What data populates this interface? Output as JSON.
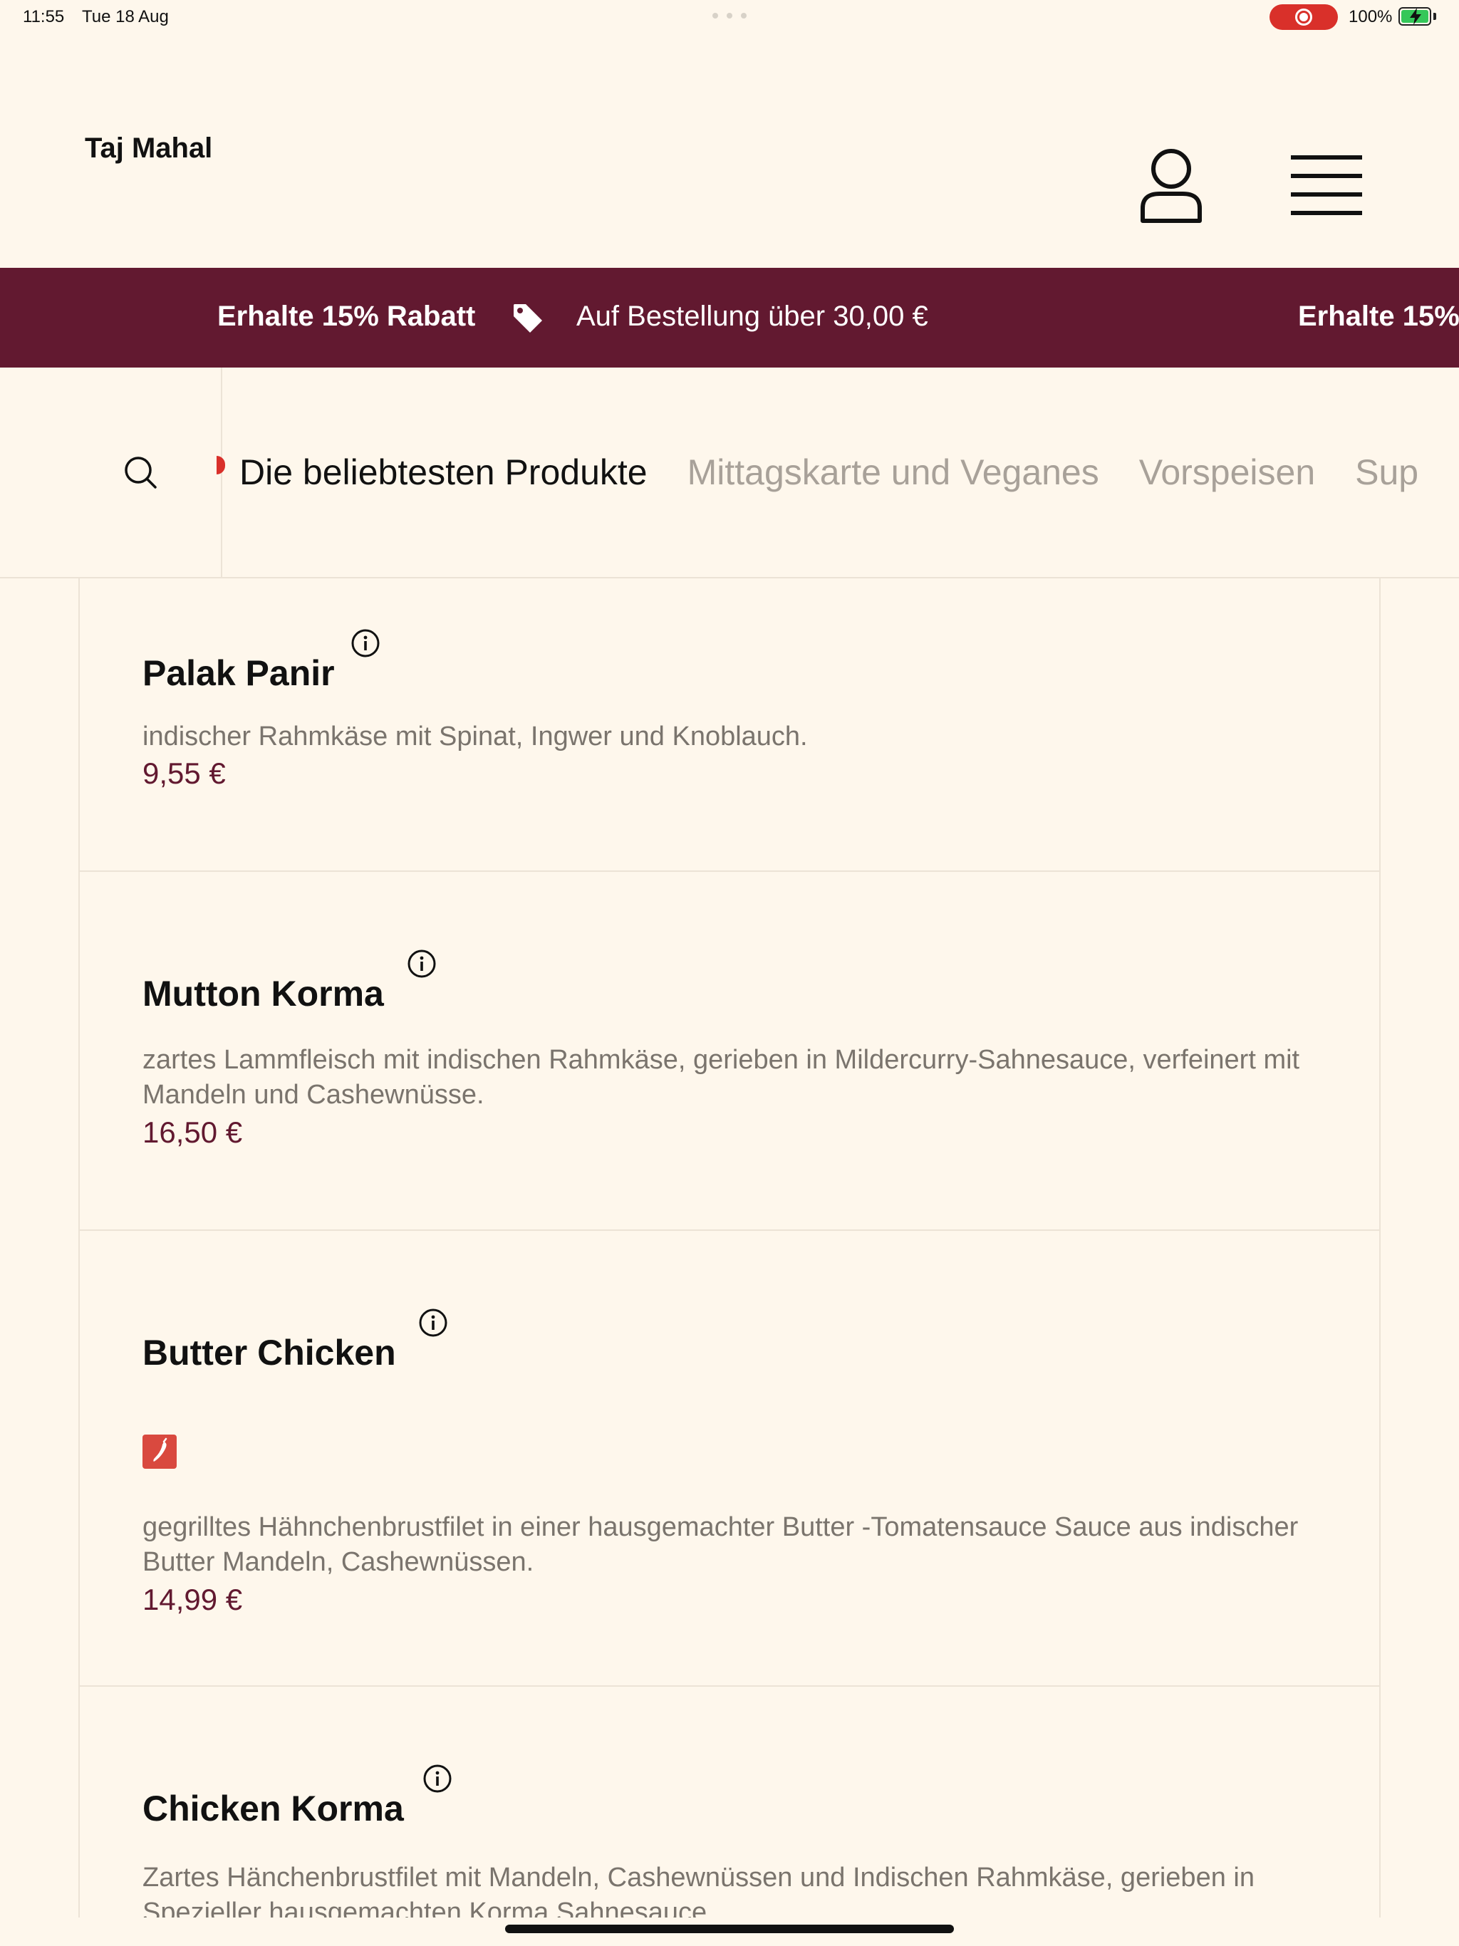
{
  "status_bar": {
    "time": "11:55",
    "date": "Tue 18 Aug",
    "battery": "100%",
    "battery_level": 1.0
  },
  "header": {
    "brand": "Taj Mahal",
    "account_icon": "user-icon",
    "menu_icon": "hamburger-menu-icon"
  },
  "promo": {
    "title": "Erhalte 15% Rabatt",
    "subtitle": "Auf Bestellung über 30,00 €",
    "title_repeat": "Erhalte 15%",
    "tag_icon": "price-tag-icon"
  },
  "categories": {
    "search_icon": "search-icon",
    "tabs": [
      {
        "label": "Die beliebtesten Produkte",
        "active": true
      },
      {
        "label": "Mittagskarte und Veganes",
        "active": false
      },
      {
        "label": "Vorspeisen",
        "active": false
      },
      {
        "label": "Sup",
        "active": false
      }
    ]
  },
  "products": [
    {
      "name": "Palak Panir",
      "description": "indischer Rahmkäse mit Spinat, Ingwer und Knoblauch.",
      "price": "9,55 €",
      "spicy": false
    },
    {
      "name": "Mutton Korma",
      "description": "zartes Lammfleisch mit indischen Rahmkäse, gerieben in Mildercurry-Sahnesauce, verfeinert mit Mandeln und Cashewnüsse.",
      "price": "16,50 €",
      "spicy": false
    },
    {
      "name": "Butter Chicken",
      "description": "gegrilltes Hähnchenbrustfilet in einer hausgemachter Butter -Tomatensauce Sauce aus indischer Butter Mandeln, Cashewnüssen.",
      "price": "14,99 €",
      "spicy": true
    },
    {
      "name": "Chicken Korma",
      "description": "Zartes Hänchenbrustfilet mit Mandeln, Cashewnüssen und Indischen Rahmkäse, gerieben in Spezieller hausgemachten Korma Sahnesauce.",
      "price": "",
      "spicy": false
    }
  ],
  "colors": {
    "background": "#fef7ec",
    "brand": "#621930",
    "accent_red": "#d9302a",
    "muted_text": "#7a746d"
  }
}
